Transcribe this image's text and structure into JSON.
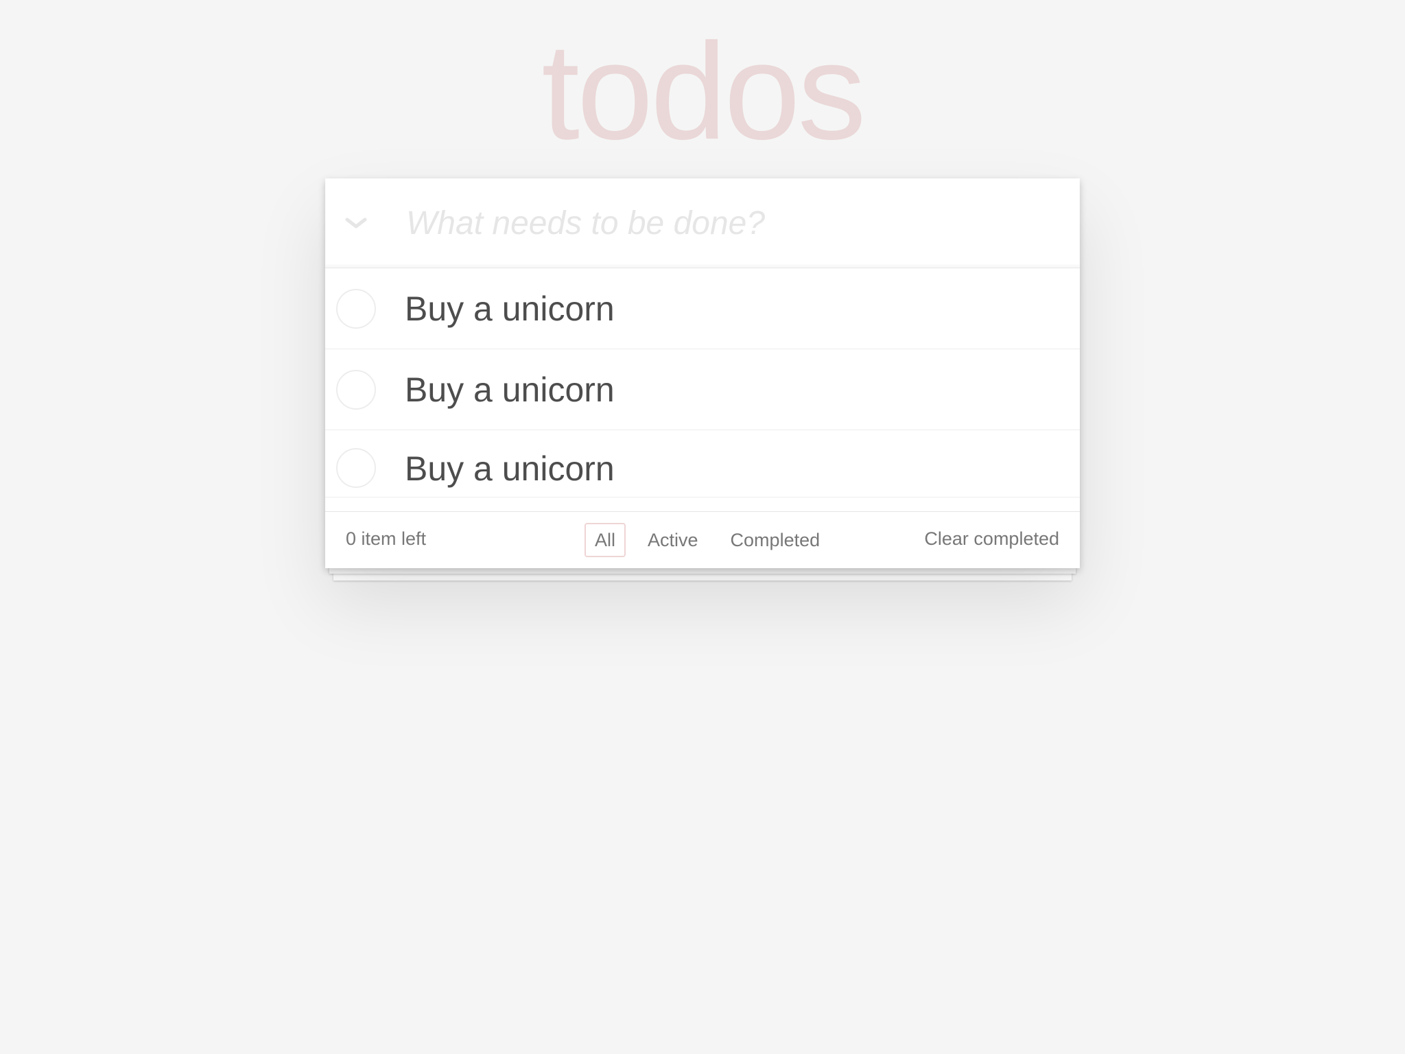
{
  "app": {
    "title": "todos"
  },
  "new_todo": {
    "placeholder": "What needs to be done?",
    "value": ""
  },
  "todos": [
    {
      "label": "Buy a unicorn",
      "completed": false
    },
    {
      "label": "Buy a unicorn",
      "completed": false
    },
    {
      "label": "Buy a unicorn",
      "completed": false
    }
  ],
  "footer": {
    "count_text": "0 item left",
    "filters": [
      {
        "label": "All",
        "selected": true
      },
      {
        "label": "Active",
        "selected": false
      },
      {
        "label": "Completed",
        "selected": false
      }
    ],
    "clear_label": "Clear completed"
  },
  "icons": {
    "toggle_all": "chevron-down-icon",
    "todo_toggle": "circle-checkbox-icon"
  },
  "colors": {
    "background": "#f5f5f5",
    "title": "rgba(175,47,47,0.15)",
    "selected_filter_border": "rgba(175,47,47,0.2)"
  }
}
